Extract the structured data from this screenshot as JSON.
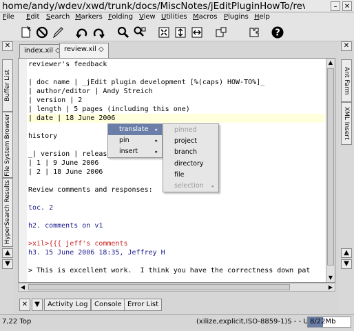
{
  "window": {
    "title": "home/andy/wdev/xwd/trunk/docs/MiscNotes/jEditPluginHowTo/review.xil",
    "minimize_glyph": "–",
    "close_glyph": "✕"
  },
  "menu": {
    "items": [
      {
        "key": "F",
        "rest": "ile"
      },
      {
        "key": "E",
        "rest": "dit"
      },
      {
        "key": "S",
        "rest": "earch"
      },
      {
        "key": "M",
        "rest": "arkers"
      },
      {
        "key": "F",
        "rest": "olding"
      },
      {
        "key": "V",
        "rest": "iew"
      },
      {
        "key": "U",
        "rest": "tilities"
      },
      {
        "key": "M",
        "rest": "acros"
      },
      {
        "key": "P",
        "rest": "lugins"
      },
      {
        "key": "H",
        "rest": "elp"
      }
    ]
  },
  "toolbar": {
    "icons": [
      "new-file-icon",
      "stop-icon",
      "edit-pencil-icon",
      "undo-icon",
      "redo-icon",
      "find-icon",
      "find-replace-icon",
      "split-icon",
      "unsplit-icon",
      "split-vertical-icon",
      "plugin-manager-icon",
      "plugin-options-icon",
      "help-icon"
    ]
  },
  "left_dock": {
    "close_glyph": "✕",
    "tabs": [
      "Buffer List",
      "File System Browser",
      "HyperSearch Results"
    ],
    "scroll_up": "▲",
    "scroll_down": "▼"
  },
  "right_dock": {
    "close_glyph": "✕",
    "tabs": [
      "Ant Farm",
      "XML Insert"
    ],
    "scroll_up": "▲",
    "scroll_down": "▼"
  },
  "buffer_tabs": [
    {
      "label": "index.xil ◇",
      "active": false
    },
    {
      "label": "review.xil ◇",
      "active": true
    }
  ],
  "editor": {
    "lines": [
      "reviewer's feedback",
      "",
      "| doc name | _jEdit plugin development [%(caps) HOW-TO%]_",
      "| author/editor | Andy Streich",
      "| version | 2",
      "| length | 5 pages (including this one)",
      "| date | 18 June 2006",
      "",
      "history",
      "",
      "_| version | releas",
      "| 1 | 9 June 2006",
      "| 2 | 18 June 2006",
      "",
      "Review comments and responses:",
      "",
      "toc. 2",
      "",
      "h2. comments on v1",
      "",
      ">xil>{{{ jeff's comments",
      "h3. 15 June 2006 18:35, Jeffrey H",
      "",
      "> This is excellent work.  I think you have the correctness down pat",
      ""
    ]
  },
  "context_menu": {
    "items": [
      {
        "label": "translate",
        "arrow": "▸"
      },
      {
        "label": "pin",
        "arrow": "▸"
      },
      {
        "label": "insert",
        "arrow": "▸"
      }
    ],
    "submenu": [
      {
        "label": "pinned",
        "disabled": true
      },
      {
        "label": "project",
        "disabled": false
      },
      {
        "label": "branch",
        "disabled": false
      },
      {
        "label": "directory",
        "disabled": false
      },
      {
        "label": "file",
        "disabled": false
      },
      {
        "label": "selection",
        "disabled": true,
        "arrow": "▸"
      }
    ]
  },
  "bottom_dock": {
    "close_glyph": "✕",
    "collapse_glyph": "▼",
    "buttons": [
      "Activity Log",
      "Console",
      "Error List"
    ]
  },
  "status": {
    "position": "7,22 Top",
    "mode": "(xilize,explicit,ISO-8859-1)S - - U",
    "memory": "8/22Mb",
    "memory_fraction": 0.36
  },
  "colors": {
    "selection": "#6a7ea8",
    "current_line": "#ffffdc",
    "markup_red": "#cc2020",
    "heading_blue": "#1a1a8a"
  }
}
